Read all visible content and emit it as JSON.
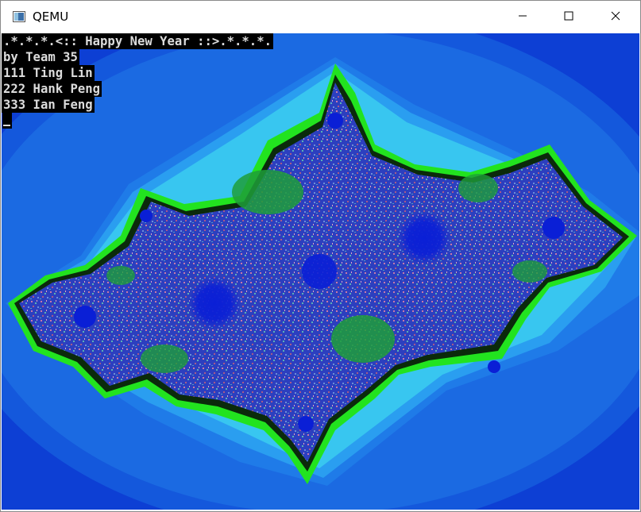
{
  "window": {
    "title": "QEMU",
    "app_icon": "qemu-monitor-icon",
    "buttons": {
      "minimize_icon": "minimize-icon",
      "maximize_icon": "maximize-icon",
      "close_icon": "close-icon"
    }
  },
  "console": {
    "lines": [
      ".*.*.*.<:: Happy New Year ::>.*.*.*.",
      "by Team 35",
      "111 Ting Lin",
      "222 Hank Peng",
      "333 Ian Feng"
    ]
  },
  "colors": {
    "background": "#0d3fd4",
    "glow_outer": "#1f7be8",
    "glow_inner": "#38c6f0",
    "edge_green": "#22e31f",
    "fractal_body": "#2a3ec0",
    "spiral_center": "#0a1fd6",
    "console_bg": "#000000",
    "console_text": "#dcdcdc"
  }
}
